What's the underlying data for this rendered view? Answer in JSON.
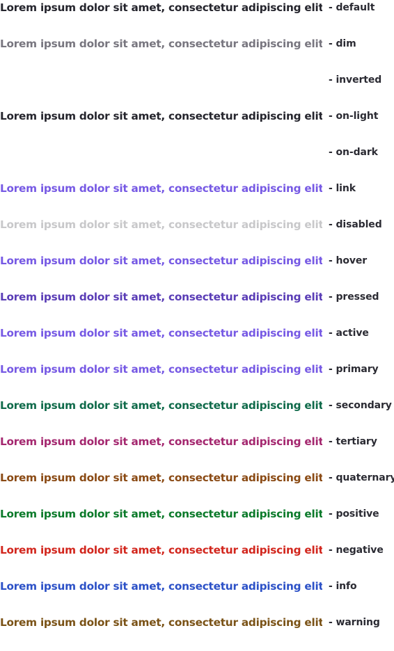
{
  "sample_text": "Lorem ipsum dolor sit amet, consectetur adipiscing elit.",
  "rows": [
    {
      "label": "- default",
      "color": "#25252d",
      "visible": true
    },
    {
      "label": "- dim",
      "color": "#78767f",
      "visible": true
    },
    {
      "label": "- inverted",
      "color": "#ffffff",
      "visible": false
    },
    {
      "label": "- on-light",
      "color": "#25252d",
      "visible": true
    },
    {
      "label": "- on-dark",
      "color": "#ffffff",
      "visible": false
    },
    {
      "label": "- link",
      "color": "#7659e4",
      "visible": true
    },
    {
      "label": "- disabled",
      "color": "#c8c8ca",
      "visible": true
    },
    {
      "label": "- hover",
      "color": "#7659e4",
      "visible": true
    },
    {
      "label": "- pressed",
      "color": "#5a3db6",
      "visible": true
    },
    {
      "label": "- active",
      "color": "#7659e4",
      "visible": true
    },
    {
      "label": "- primary",
      "color": "#7659e4",
      "visible": true
    },
    {
      "label": "- secondary",
      "color": "#0f6a4a",
      "visible": true
    },
    {
      "label": "- tertiary",
      "color": "#a4276f",
      "visible": true
    },
    {
      "label": "- quaternary",
      "color": "#8a4a14",
      "visible": true
    },
    {
      "label": "- positive",
      "color": "#0b7a2a",
      "visible": true
    },
    {
      "label": "- negative",
      "color": "#d2261d",
      "visible": true
    },
    {
      "label": "- info",
      "color": "#2c51c7",
      "visible": true
    },
    {
      "label": "- warning",
      "color": "#7a5216",
      "visible": true
    }
  ]
}
